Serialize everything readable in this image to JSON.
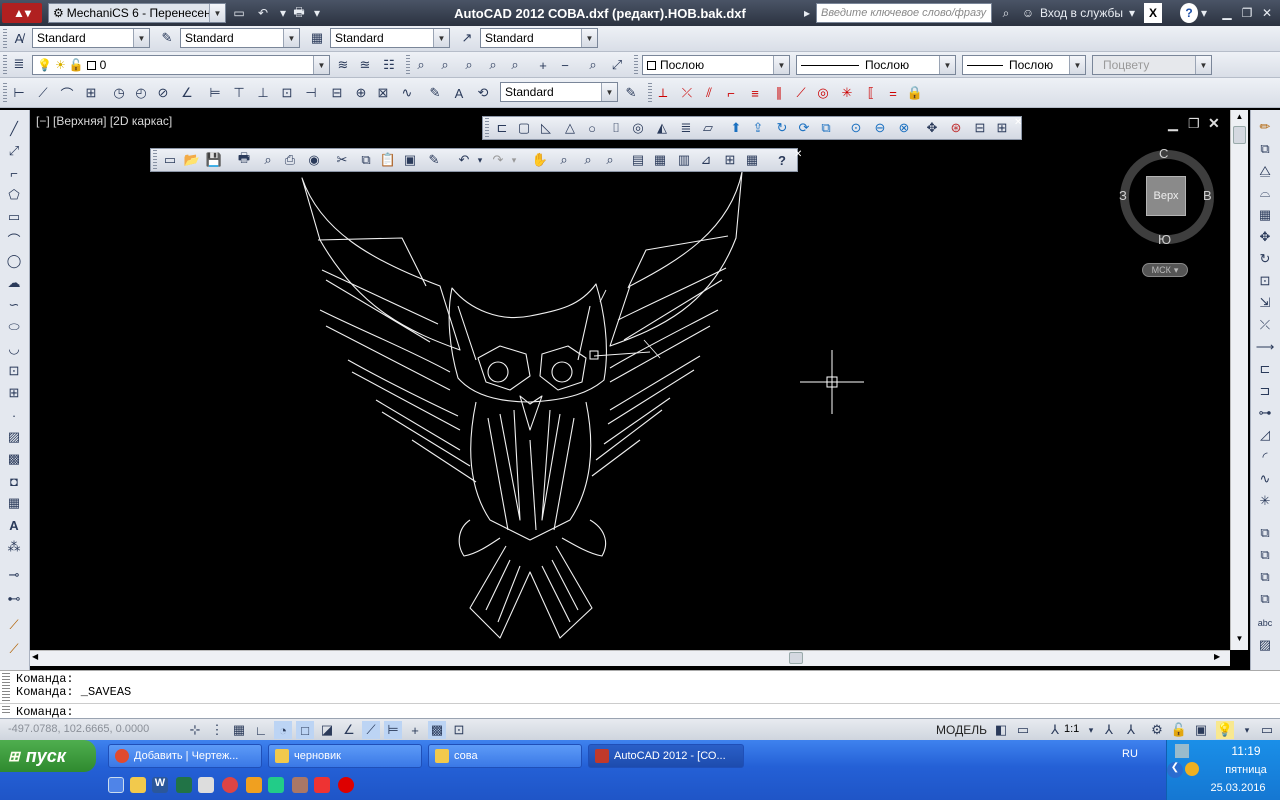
{
  "titlebar": {
    "workspace": "MechaniCS 6 - Перенесен...",
    "app_title": "AutoCAD 2012     СОВА.dxf (редакт).НОВ.bak.dxf",
    "search_placeholder": "Введите ключевое слово/фразу",
    "signin": "Вход в службы",
    "help": "?"
  },
  "styles_toolbar": {
    "text_style": "Standard",
    "dim_style": "Standard",
    "table_style": "Standard",
    "mleader_style": "Standard"
  },
  "layers_toolbar": {
    "layer_name": "0",
    "color": "Послою",
    "linetype": "Послою",
    "lineweight": "Послою",
    "plotstyle": "Поцвету"
  },
  "dim_toolbar": {
    "dim_style": "Standard"
  },
  "viewport": {
    "label": "[−] [Верхняя] [2D каркас]"
  },
  "viewcube": {
    "north": "С",
    "south": "Ю",
    "west": "З",
    "east": "В",
    "face": "Верх",
    "ucs": "МСК"
  },
  "command": {
    "line1": "Команда:",
    "line2": "Команда:  _SAVEAS",
    "prompt": "Команда:"
  },
  "status": {
    "coords": "-497.0788, 102.6665, 0.0000",
    "model": "МОДЕЛЬ",
    "scale": "1:1"
  },
  "taskbar": {
    "start": "пуск",
    "tasks": [
      {
        "label": "Добавить | Чертеж...",
        "color": "#e04a2f"
      },
      {
        "label": "черновик",
        "color": "#f2c94c"
      },
      {
        "label": "сова",
        "color": "#f2c94c"
      },
      {
        "label": "AutoCAD 2012 - [СО...",
        "color": "#c0392b"
      }
    ],
    "lang": "RU",
    "time": "11:19",
    "day": "пятница",
    "date": "25.03.2016"
  },
  "colors": {
    "title_bg": "#2b3240",
    "taskbar": "#2460d6",
    "start": "#3c9a3c",
    "viewport": "#000000"
  }
}
